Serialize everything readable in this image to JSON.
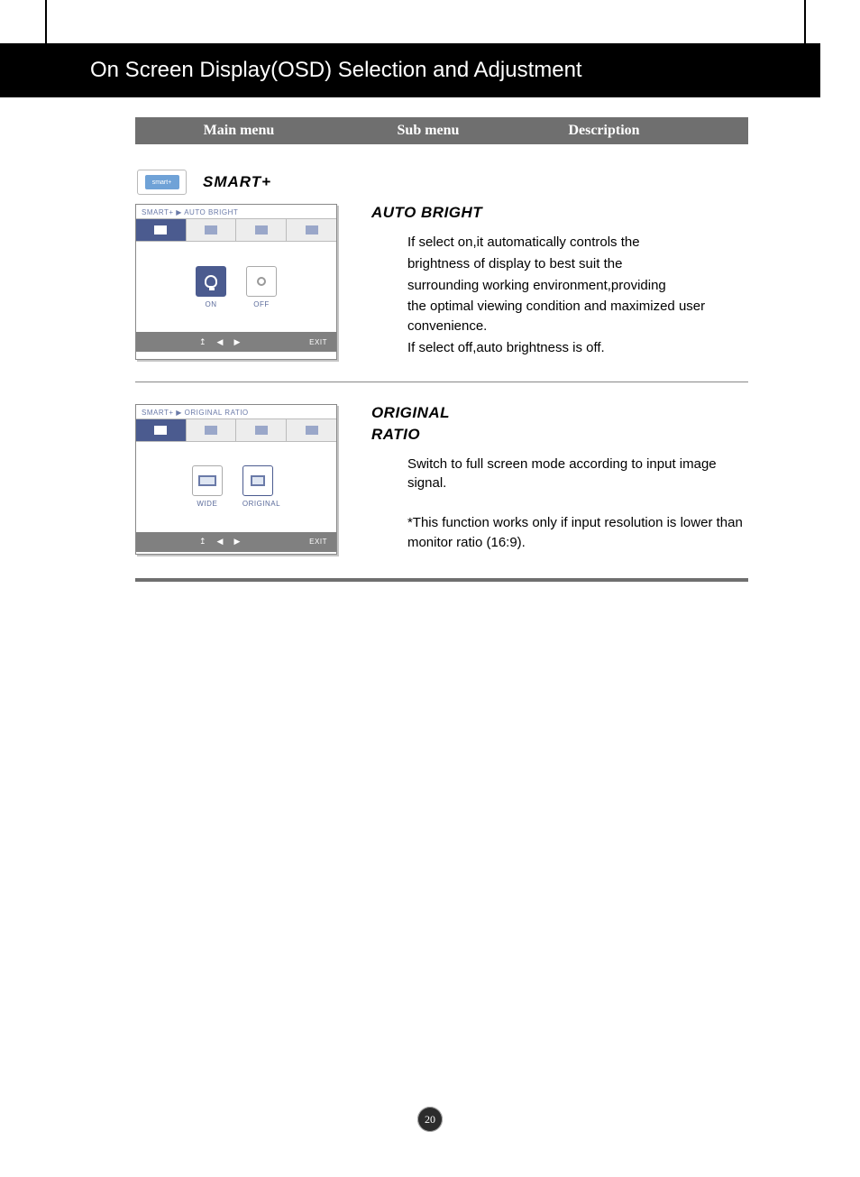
{
  "header": {
    "title": "On Screen Display(OSD) Selection and Adjustment"
  },
  "columns": {
    "c1": "Main menu",
    "c2": "Sub menu",
    "c3": "Description"
  },
  "badge": {
    "text": "smart+"
  },
  "smart_label": "SMART+",
  "osd1": {
    "breadcrumb_a": "SMART+",
    "breadcrumb_b": "AUTO BRIGHT",
    "opt_on": "ON",
    "opt_off": "OFF",
    "exit": "EXIT"
  },
  "sec1": {
    "title": "AUTO BRIGHT",
    "p1": "If select on,it automatically controls the",
    "p2": "brightness of display to best suit the",
    "p3": "surrounding working environment,providing",
    "p4": "the optimal viewing condition and maximized user convenience.",
    "p5": "If select off,auto brightness is off."
  },
  "osd2": {
    "breadcrumb_a": "SMART+",
    "breadcrumb_b": "ORIGINAL RATIO",
    "opt_wide": "WIDE",
    "opt_orig": "ORIGINAL",
    "exit": "EXIT"
  },
  "sec2": {
    "title_l1": "ORIGINAL",
    "title_l2": "RATIO",
    "p1": "Switch to full screen mode according to input image signal.",
    "p2": "*This function works only if input resolution is lower than monitor ratio (16:9)."
  },
  "page": "20"
}
